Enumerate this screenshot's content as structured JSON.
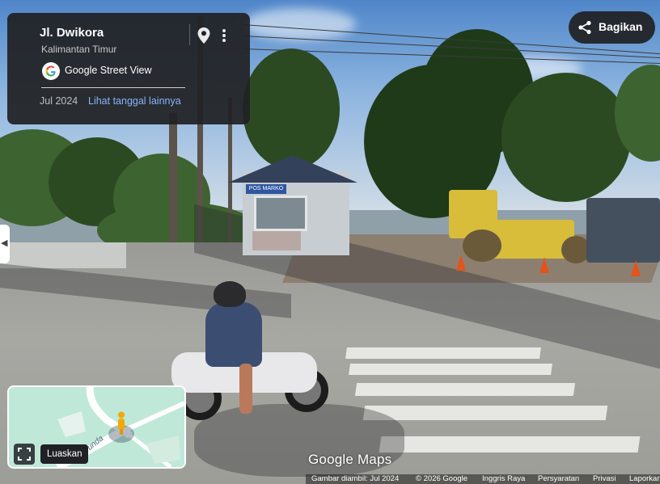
{
  "info_card": {
    "street": "Jl. Dwikora",
    "region": "Kalimantan Timur",
    "source_label": "Google Street View",
    "capture_date": "Jul 2024",
    "see_more_dates": "Lihat tanggal lainnya"
  },
  "share": {
    "label": "Bagikan"
  },
  "minimap": {
    "street_fragment": "unda",
    "expand_label": "Luaskan"
  },
  "watermark": "Google Maps",
  "footer": {
    "capture_info": "Gambar diambil: Jul 2024",
    "copyright": "© 2026 Google",
    "country": "Inggris Raya",
    "terms": "Persyaratan",
    "privacy": "Privasi",
    "report": "Laporkan"
  },
  "scene": {
    "booth_sign": "POS MARKO"
  },
  "colors": {
    "panel": "#202124",
    "link": "#8ab4f8",
    "minimap_bg": "#bfe8d9",
    "pegman": "#f2a900"
  }
}
